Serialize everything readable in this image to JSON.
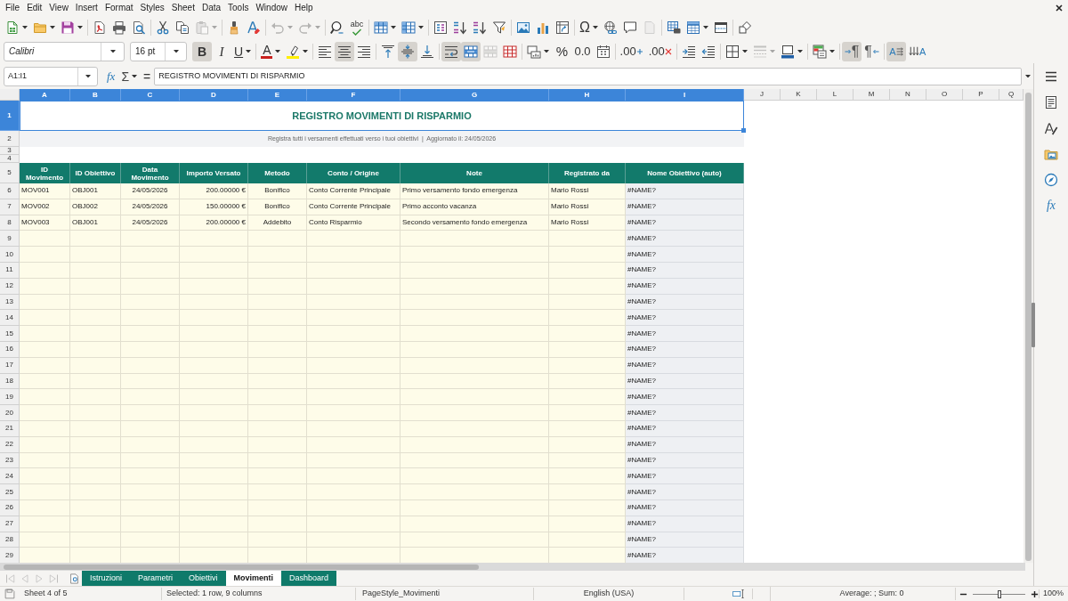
{
  "menu_bar": [
    "File",
    "Edit",
    "View",
    "Insert",
    "Format",
    "Styles",
    "Sheet",
    "Data",
    "Tools",
    "Window",
    "Help"
  ],
  "standard_toolbar": [
    [
      {
        "kind": "new",
        "dropdown": true,
        "disabled": false
      },
      {
        "kind": "open",
        "dropdown": true,
        "disabled": false
      },
      {
        "kind": "save",
        "dropdown": true,
        "disabled": false
      }
    ],
    [
      {
        "kind": "pdf",
        "dropdown": false,
        "disabled": false
      },
      {
        "kind": "print",
        "dropdown": false,
        "disabled": false
      },
      {
        "kind": "preview",
        "dropdown": false,
        "disabled": false
      }
    ],
    [
      {
        "kind": "cut",
        "dropdown": false,
        "disabled": false
      },
      {
        "kind": "copy",
        "dropdown": false,
        "disabled": false
      },
      {
        "kind": "paste",
        "dropdown": true,
        "disabled": true
      }
    ],
    [
      {
        "kind": "clone",
        "dropdown": false,
        "disabled": false
      },
      {
        "kind": "clear",
        "dropdown": false,
        "disabled": false
      }
    ],
    [
      {
        "kind": "undo",
        "dropdown": true,
        "disabled": true
      },
      {
        "kind": "redo",
        "dropdown": true,
        "disabled": true
      }
    ],
    [
      {
        "kind": "find",
        "dropdown": false,
        "disabled": false
      },
      {
        "kind": "spelling",
        "label": "abc",
        "dropdown": false,
        "disabled": false
      }
    ],
    [
      {
        "kind": "rows",
        "dropdown": true,
        "disabled": false
      },
      {
        "kind": "columns",
        "dropdown": true,
        "disabled": false
      }
    ],
    [
      {
        "kind": "sort",
        "dropdown": false,
        "disabled": false
      },
      {
        "kind": "sortasc",
        "dropdown": false,
        "disabled": false
      },
      {
        "kind": "sortdesc",
        "dropdown": false,
        "disabled": false
      },
      {
        "kind": "autofilter",
        "dropdown": false,
        "disabled": false
      }
    ],
    [
      {
        "kind": "image",
        "dropdown": false,
        "disabled": false
      },
      {
        "kind": "chart",
        "dropdown": false,
        "disabled": false
      },
      {
        "kind": "pivot",
        "dropdown": false,
        "disabled": false
      }
    ],
    [
      {
        "kind": "special",
        "label": "Ω",
        "dropdown": true,
        "disabled": false
      },
      {
        "kind": "hyperlink",
        "dropdown": false,
        "disabled": false
      },
      {
        "kind": "comment",
        "dropdown": false,
        "disabled": false
      },
      {
        "kind": "headerfooter",
        "dropdown": false,
        "disabled": true
      }
    ],
    [
      {
        "kind": "printarea",
        "dropdown": false,
        "disabled": false
      },
      {
        "kind": "freeze",
        "dropdown": true,
        "disabled": false
      },
      {
        "kind": "split",
        "dropdown": false,
        "disabled": false
      }
    ],
    [
      {
        "kind": "shapes",
        "dropdown": false,
        "disabled": false
      }
    ]
  ],
  "format_toolbar": {
    "font_name": "Calibri",
    "font_size": "16 pt",
    "groups": [
      [
        {
          "kind": "bold",
          "label": "B",
          "pressed": true,
          "dropdown": false,
          "disabled": false
        },
        {
          "kind": "italic",
          "label": "I",
          "pressed": false,
          "dropdown": false,
          "disabled": false
        },
        {
          "kind": "underline",
          "label": "U",
          "pressed": false,
          "dropdown": true,
          "disabled": false
        }
      ],
      [
        {
          "kind": "fontcolor",
          "label": "A",
          "pressed": false,
          "dropdown": true,
          "disabled": false
        },
        {
          "kind": "highlight",
          "pressed": false,
          "dropdown": true,
          "disabled": false
        }
      ],
      [
        {
          "kind": "alignleft",
          "pressed": false,
          "dropdown": false,
          "disabled": false
        },
        {
          "kind": "aligncenter",
          "pressed": true,
          "dropdown": false,
          "disabled": false
        },
        {
          "kind": "alignright",
          "pressed": false,
          "dropdown": false,
          "disabled": false
        }
      ],
      [
        {
          "kind": "aligntop",
          "pressed": false,
          "dropdown": false,
          "disabled": false
        },
        {
          "kind": "alignmiddle",
          "pressed": true,
          "dropdown": false,
          "disabled": false
        },
        {
          "kind": "alignbottom",
          "pressed": false,
          "dropdown": false,
          "disabled": false
        }
      ],
      [
        {
          "kind": "wrap",
          "pressed": true,
          "dropdown": false,
          "disabled": false
        },
        {
          "kind": "mergecenter",
          "pressed": true,
          "dropdown": false,
          "disabled": false
        },
        {
          "kind": "merge",
          "pressed": false,
          "dropdown": false,
          "disabled": true
        },
        {
          "kind": "unmerge",
          "pressed": false,
          "dropdown": false,
          "disabled": false
        }
      ],
      [
        {
          "kind": "numformat",
          "pressed": false,
          "dropdown": true,
          "disabled": false
        },
        {
          "kind": "percent",
          "label": "%",
          "pressed": false,
          "dropdown": false,
          "disabled": false
        },
        {
          "kind": "decimal",
          "label": "0.0",
          "pressed": false,
          "dropdown": false,
          "disabled": false
        },
        {
          "kind": "date",
          "pressed": false,
          "dropdown": false,
          "disabled": false
        }
      ],
      [
        {
          "kind": "adddecimal",
          "label": ".00",
          "pressed": false,
          "dropdown": false,
          "disabled": false
        },
        {
          "kind": "deldecimal",
          "label": ".00",
          "pressed": false,
          "dropdown": false,
          "disabled": false
        }
      ],
      [
        {
          "kind": "indentmore",
          "pressed": false,
          "dropdown": false,
          "disabled": false
        },
        {
          "kind": "indentless",
          "pressed": false,
          "dropdown": false,
          "disabled": false
        }
      ],
      [
        {
          "kind": "borders",
          "pressed": false,
          "dropdown": true,
          "disabled": false
        },
        {
          "kind": "borderstyle",
          "pressed": false,
          "dropdown": true,
          "disabled": true
        },
        {
          "kind": "bordercolor",
          "pressed": false,
          "dropdown": true,
          "disabled": false
        }
      ],
      [
        {
          "kind": "conditional",
          "pressed": false,
          "dropdown": true,
          "disabled": false
        }
      ],
      [
        {
          "kind": "ltr",
          "label": "¶",
          "pressed": true,
          "dropdown": false,
          "disabled": false
        },
        {
          "kind": "rtl",
          "label": "¶",
          "pressed": false,
          "dropdown": false,
          "disabled": false
        }
      ],
      [
        {
          "kind": "texthorizontal",
          "label": "A",
          "pressed": true,
          "dropdown": false,
          "disabled": false
        },
        {
          "kind": "textvertical",
          "label": "A",
          "pressed": false,
          "dropdown": false,
          "disabled": false
        }
      ]
    ]
  },
  "formula_bar": {
    "name_box": "A1:I1",
    "wizard_label": "fx",
    "sum_label": "Σ",
    "equals_label": "=",
    "formula": "REGISTRO MOVIMENTI DI RISPARMIO"
  },
  "sheet": {
    "columns": [
      {
        "label": "A",
        "selected": true
      },
      {
        "label": "B",
        "selected": true
      },
      {
        "label": "C",
        "selected": true
      },
      {
        "label": "D",
        "selected": true
      },
      {
        "label": "E",
        "selected": true
      },
      {
        "label": "F",
        "selected": true
      },
      {
        "label": "G",
        "selected": true
      },
      {
        "label": "H",
        "selected": true
      },
      {
        "label": "I",
        "selected": true
      },
      {
        "label": "J",
        "selected": false
      },
      {
        "label": "K",
        "selected": false
      },
      {
        "label": "L",
        "selected": false
      },
      {
        "label": "M",
        "selected": false
      },
      {
        "label": "N",
        "selected": false
      },
      {
        "label": "O",
        "selected": false
      },
      {
        "label": "P",
        "selected": false
      },
      {
        "label": "Q",
        "selected": false
      }
    ],
    "rows": [
      {
        "label": "1",
        "selected": true
      },
      {
        "label": "2",
        "selected": false
      },
      {
        "label": "3",
        "selected": false
      },
      {
        "label": "4",
        "selected": false
      },
      {
        "label": "5",
        "selected": false
      },
      {
        "label": "6",
        "selected": false
      },
      {
        "label": "7",
        "selected": false
      },
      {
        "label": "8",
        "selected": false
      },
      {
        "label": "9",
        "selected": false
      },
      {
        "label": "10",
        "selected": false
      },
      {
        "label": "11",
        "selected": false
      },
      {
        "label": "12",
        "selected": false
      },
      {
        "label": "13",
        "selected": false
      },
      {
        "label": "14",
        "selected": false
      },
      {
        "label": "15",
        "selected": false
      },
      {
        "label": "16",
        "selected": false
      },
      {
        "label": "17",
        "selected": false
      },
      {
        "label": "18",
        "selected": false
      },
      {
        "label": "19",
        "selected": false
      },
      {
        "label": "20",
        "selected": false
      },
      {
        "label": "21",
        "selected": false
      },
      {
        "label": "22",
        "selected": false
      },
      {
        "label": "23",
        "selected": false
      },
      {
        "label": "24",
        "selected": false
      },
      {
        "label": "25",
        "selected": false
      },
      {
        "label": "26",
        "selected": false
      },
      {
        "label": "27",
        "selected": false
      },
      {
        "label": "28",
        "selected": false
      },
      {
        "label": "29",
        "selected": false
      }
    ],
    "title": "REGISTRO MOVIMENTI DI RISPARMIO",
    "subtitle": "Registra tutti i versamenti effettuati verso i tuoi obiettivi  |  Aggiornato il: 24/05/2026",
    "headers": [
      "ID Movimento",
      "ID Obiettivo",
      "Data Movimento",
      "Importo Versato",
      "Metodo",
      "Conto / Origine",
      "Note",
      "Registrato da",
      "Nome Obiettivo (auto)"
    ],
    "records": [
      {
        "A": "MOV001",
        "B": "OBJ001",
        "C": "24/05/2026",
        "D": "200.00000 €",
        "E": "Bonifico",
        "F": "Conto Corrente Principale",
        "G": "Primo versamento fondo emergenza",
        "H": "Mario Rossi",
        "I": "#NAME?"
      },
      {
        "A": "MOV002",
        "B": "OBJ002",
        "C": "24/05/2026",
        "D": "150.00000 €",
        "E": "Bonifico",
        "F": "Conto Corrente Principale",
        "G": "Primo acconto vacanza",
        "H": "Mario Rossi",
        "I": "#NAME?"
      },
      {
        "A": "MOV003",
        "B": "OBJ001",
        "C": "24/05/2026",
        "D": "200.00000 €",
        "E": "Addebito",
        "F": "Conto Risparmio",
        "G": "Secondo versamento fondo emergenza",
        "H": "Mario Rossi",
        "I": "#NAME?"
      },
      {
        "I": "#NAME?"
      },
      {
        "I": "#NAME?"
      },
      {
        "I": "#NAME?"
      },
      {
        "I": "#NAME?"
      },
      {
        "I": "#NAME?"
      },
      {
        "I": "#NAME?"
      },
      {
        "I": "#NAME?"
      },
      {
        "I": "#NAME?"
      },
      {
        "I": "#NAME?"
      },
      {
        "I": "#NAME?"
      },
      {
        "I": "#NAME?"
      },
      {
        "I": "#NAME?"
      },
      {
        "I": "#NAME?"
      },
      {
        "I": "#NAME?"
      },
      {
        "I": "#NAME?"
      },
      {
        "I": "#NAME?"
      },
      {
        "I": "#NAME?"
      },
      {
        "I": "#NAME?"
      },
      {
        "I": "#NAME?"
      },
      {
        "I": "#NAME?"
      },
      {
        "I": "#NAME?"
      }
    ]
  },
  "sidebar": {
    "functions_label": "fx"
  },
  "sheet_navigation": [
    {
      "kind": "first",
      "disabled": true
    },
    {
      "kind": "previous",
      "disabled": true
    },
    {
      "kind": "next",
      "disabled": true
    },
    {
      "kind": "last",
      "disabled": true
    }
  ],
  "sheet_tabs": [
    {
      "label": "Istruzioni",
      "selected": false
    },
    {
      "label": "Parametri",
      "selected": false
    },
    {
      "label": "Obiettivi",
      "selected": false
    },
    {
      "label": "Movimenti",
      "selected": true
    },
    {
      "label": "Dashboard",
      "selected": false
    }
  ],
  "status_bar": {
    "sheet": "Sheet 4 of 5",
    "selection": "Selected: 1 row, 9 columns",
    "page_style": "PageStyle_Movimenti",
    "language": "English (USA)",
    "summary": "Average: ; Sum: 0",
    "zoom": {
      "level": 0.5,
      "label": "100%"
    }
  }
}
